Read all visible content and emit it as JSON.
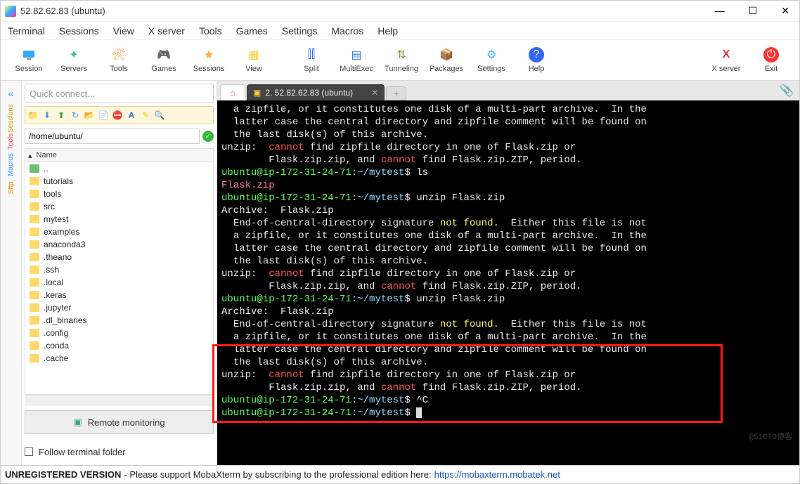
{
  "window": {
    "title": "52.82.62.83 (ubuntu)"
  },
  "menu": [
    "Terminal",
    "Sessions",
    "View",
    "X server",
    "Tools",
    "Games",
    "Settings",
    "Macros",
    "Help"
  ],
  "toolbar": [
    {
      "label": "Session",
      "color": "#33aaff"
    },
    {
      "label": "Servers",
      "color": "#33cc66"
    },
    {
      "label": "Tools",
      "color": "#ff9933"
    },
    {
      "label": "Games",
      "color": "#ffcc33"
    },
    {
      "label": "Sessions",
      "color": "#ffaa33"
    },
    {
      "label": "View",
      "color": "#ffcc33"
    },
    {
      "label": "Split",
      "color": "#3366ff"
    },
    {
      "label": "MultiExec",
      "color": "#3377cc"
    },
    {
      "label": "Tunneling",
      "color": "#66aa44"
    },
    {
      "label": "Packages",
      "color": "#996644"
    },
    {
      "label": "Settings",
      "color": "#33bbff"
    },
    {
      "label": "Help",
      "color": "#3366ff"
    }
  ],
  "toolbar_right": [
    {
      "label": "X server",
      "color": "#ff3333"
    },
    {
      "label": "Exit",
      "color": "#ff3333"
    }
  ],
  "quick": {
    "placeholder": "Quick connect..."
  },
  "sidetabs": [
    "Sessions",
    "Tools",
    "Macros",
    "Sftp"
  ],
  "path": "/home/ubuntu/",
  "file_header": "Name",
  "files": [
    {
      "name": "..",
      "up": true
    },
    {
      "name": "tutorials"
    },
    {
      "name": "tools"
    },
    {
      "name": "src"
    },
    {
      "name": "mytest"
    },
    {
      "name": "examples"
    },
    {
      "name": "anaconda3"
    },
    {
      "name": ".theano"
    },
    {
      "name": ".ssh"
    },
    {
      "name": ".local"
    },
    {
      "name": ".keras"
    },
    {
      "name": ".jupyter"
    },
    {
      "name": ".dl_binaries"
    },
    {
      "name": ".config"
    },
    {
      "name": ".conda"
    },
    {
      "name": ".cache"
    }
  ],
  "remote_mon": "Remote monitoring",
  "follow": "Follow terminal folder",
  "tabs": {
    "session": "2. 52.82.62.83 (ubuntu)"
  },
  "term": {
    "l1": "  a zipfile, or it constitutes one disk of a multi-part archive.  In the",
    "l2": "  latter case the central directory and zipfile comment will be found on",
    "l3": "  the last disk(s) of this archive.",
    "l4a": "unzip:  ",
    "l4b": "cannot",
    "l4c": " find zipfile directory in one of Flask.zip or",
    "l5a": "        Flask.zip.zip, and ",
    "l5b": "cannot",
    "l5c": " find Flask.zip.ZIP, period.",
    "p1u": "ubuntu@ip-172-31-24-71",
    "p1h": ":",
    "p1p": "~/mytest",
    "p1d": "$ ls",
    "ls_out": "Flask.zip",
    "p2u": "ubuntu@ip-172-31-24-71",
    "p2p": "~/mytest",
    "p2c": "$ unzip Flask.zip",
    "ar": "Archive:  Flask.zip",
    "e1a": "  End-of-central-directory signature ",
    "e1b": "not found",
    "e1c": ".  Either this file is not",
    "e2": "  a zipfile, or it constitutes one disk of a multi-part archive.  In the",
    "e3": "  latter case the central directory and zipfile comment will be found on",
    "e4": "  the last disk(s) of this archive.",
    "u2a": "unzip:  ",
    "u2b": "cannot",
    "u2c": " find zipfile directory in one of Flask.zip or",
    "u3a": "        Flask.zip.zip, and ",
    "u3b": "cannot",
    "u3c": " find Flask.zip.ZIP, period.",
    "p3c": "$ unzip Flask.zip",
    "p4c": "$ ^C",
    "p5c": "$ "
  },
  "status": {
    "a": "UNREGISTERED VERSION",
    "b": "  -  Please support MobaXterm by subscribing to the professional edition here:  ",
    "link": "https://mobaxterm.mobatek.net"
  },
  "watermark": "@51CTO博客"
}
